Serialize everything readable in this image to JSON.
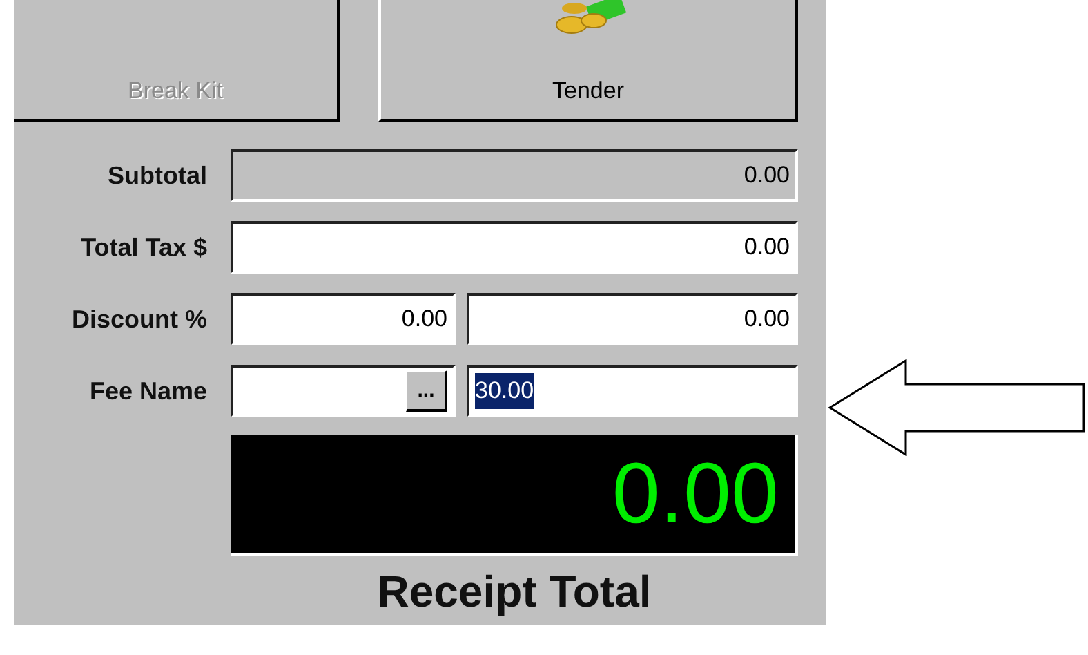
{
  "buttons": [
    {
      "label": "Break Kit",
      "disabled": true,
      "icon": false
    },
    {
      "label": "Tender",
      "disabled": false,
      "icon": true
    }
  ],
  "rows": [
    {
      "label": "Subtotal",
      "fields": [
        {
          "value": "0.00",
          "disabled": true
        }
      ]
    },
    {
      "label": "Total Tax $",
      "fields": [
        {
          "value": "0.00",
          "disabled": false
        }
      ]
    },
    {
      "label": "Discount %",
      "fields": [
        {
          "value": "0.00",
          "disabled": false
        },
        {
          "value": "0.00",
          "disabled": false
        }
      ]
    },
    {
      "label": "Fee Name",
      "fields": [
        {
          "disabled": false,
          "browse": "..."
        },
        {
          "value": "30.00",
          "disabled": false,
          "selected": true
        }
      ]
    }
  ],
  "total": {
    "value": "0.00",
    "label": "Receipt Total"
  }
}
